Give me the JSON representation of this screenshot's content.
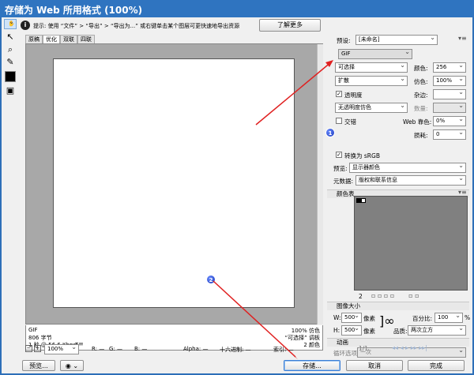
{
  "window": {
    "title": "存储为 Web 所用格式 (100%)"
  },
  "info": {
    "tip": "提示: 使用 “文件” > “导出” > “导出为...” 或右键单击某个图层可更快速地导出资源",
    "learn_more": "了解更多"
  },
  "tabs": [
    "原稿",
    "优化",
    "双联",
    "四联"
  ],
  "image_info": {
    "format": "GIF",
    "size": "806 字节",
    "time": "1 秒 @ 56.6 Kbps",
    "quality": "100% 仿色",
    "palette": "“可选择” 调板",
    "colors": "2 颜色"
  },
  "status": {
    "zoom": "100%",
    "r": "R: —",
    "g": "G: —",
    "b": "B: —",
    "alpha": "Alpha: —",
    "hex": "十六进制: —",
    "index": "索引: —"
  },
  "buttons": {
    "preview": "预览...",
    "save": "存储...",
    "cancel": "取消",
    "done": "完成"
  },
  "settings": {
    "preset_label": "预设:",
    "preset_value": "[未命名]",
    "format": "GIF",
    "reduction": "可选择",
    "colors_label": "颜色:",
    "colors_value": "256",
    "dither_algo": "扩散",
    "dither_label": "仿色:",
    "dither_value": "100%",
    "transparency": "透明度",
    "matte_label": "杂边:",
    "transparency_dither": "无透明度仿色",
    "amount_label": "数量:",
    "interlaced": "交错",
    "websnap_label": "Web 靠色:",
    "websnap_value": "0%",
    "lossy_label": "损耗:",
    "lossy_value": "0",
    "convert_srgb": "转换为 sRGB",
    "preview_label": "预览:",
    "preview_value": "显示器颜色",
    "metadata_label": "元数据:",
    "metadata_value": "版权和联系信息"
  },
  "color_table": {
    "title": "颜色表",
    "count": "2",
    "swatches": [
      "#000000",
      "#ffffff"
    ]
  },
  "image_size": {
    "title": "图像大小",
    "w_label": "W:",
    "w_value": "500",
    "h_label": "H:",
    "h_value": "500",
    "unit": "像素",
    "percent_label": "百分比:",
    "percent_value": "100",
    "percent_unit": "%",
    "quality_label": "品质:",
    "quality_value": "两次立方"
  },
  "animation": {
    "title": "动画",
    "loop_label": "循环选项:",
    "loop_value": "一次",
    "frame": "1/1"
  },
  "markers": [
    "1",
    "2"
  ]
}
